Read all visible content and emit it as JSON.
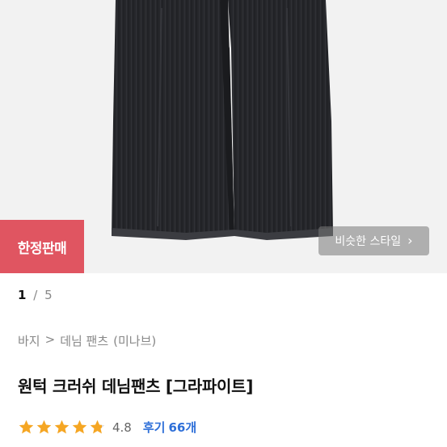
{
  "hero": {
    "limited_badge": "한정판매",
    "similar_style_label": "비슷한 스타일",
    "similar_style_icon": "chevron-right-icon"
  },
  "pager": {
    "current": "1",
    "separator": "/",
    "total": "5"
  },
  "breadcrumb": {
    "category": "바지",
    "separator": ">",
    "subcategory": "데님 팬츠",
    "brand": "(미나브)"
  },
  "product": {
    "title": "원턱 크러쉬 데님팬츠 [그라파이트]"
  },
  "rating": {
    "value": "4.8",
    "stars_value": 4.8,
    "star_color": "#f5a623",
    "reviews_label": "후기",
    "reviews_count": "66개"
  },
  "colors": {
    "badge_bg": "#e05561",
    "link": "#2e6fd8"
  }
}
